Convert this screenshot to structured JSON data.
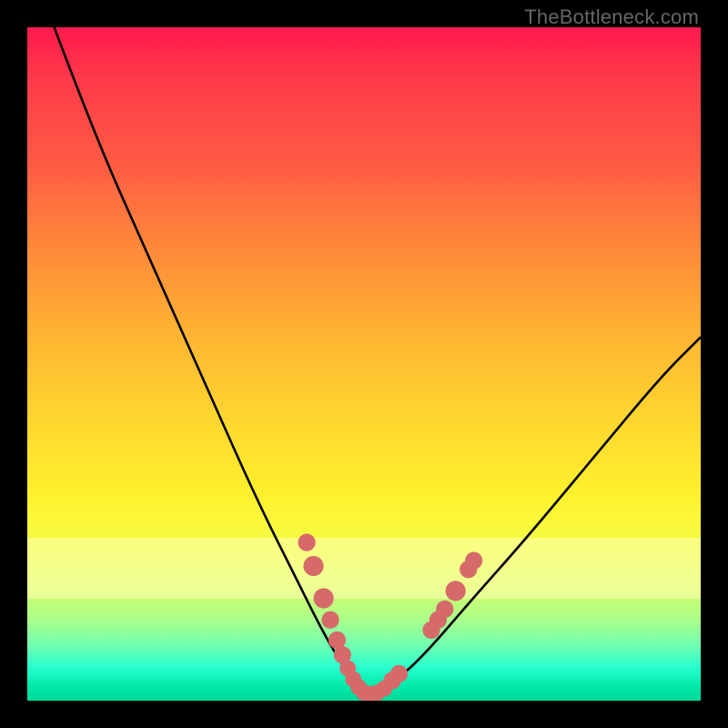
{
  "watermark": "TheBottleneck.com",
  "colors": {
    "frame": "#000000",
    "gradient_top": "#ff1a4d",
    "gradient_bottom": "#00d898",
    "curve": "#000000",
    "dots": "#d66a6a",
    "band": "#ffffb4"
  },
  "chart_data": {
    "type": "line",
    "title": "",
    "xlabel": "",
    "ylabel": "",
    "xlim": [
      0,
      100
    ],
    "ylim": [
      0,
      100
    ],
    "grid": false,
    "legend": false,
    "series": [
      {
        "name": "bottleneck-curve",
        "x": [
          4,
          10,
          18,
          26,
          34,
          40,
          44,
          47,
          49,
          50,
          51,
          53,
          56,
          60,
          66,
          74,
          84,
          94,
          100
        ],
        "y": [
          100,
          84,
          66,
          48,
          30,
          18,
          10,
          5,
          2,
          1,
          1,
          2,
          4,
          8,
          15,
          24,
          36,
          48,
          54
        ]
      }
    ],
    "markers": [
      {
        "x": 41.5,
        "y": 23.5,
        "r": 1.3
      },
      {
        "x": 42.5,
        "y": 20.0,
        "r": 1.5
      },
      {
        "x": 44.0,
        "y": 15.2,
        "r": 1.5
      },
      {
        "x": 45.0,
        "y": 12.0,
        "r": 1.3
      },
      {
        "x": 46.0,
        "y": 9.0,
        "r": 1.3
      },
      {
        "x": 46.8,
        "y": 6.8,
        "r": 1.3
      },
      {
        "x": 47.6,
        "y": 4.8,
        "r": 1.2
      },
      {
        "x": 48.4,
        "y": 3.2,
        "r": 1.2
      },
      {
        "x": 49.2,
        "y": 2.0,
        "r": 1.2
      },
      {
        "x": 50.0,
        "y": 1.2,
        "r": 1.2
      },
      {
        "x": 51.0,
        "y": 1.0,
        "r": 1.2
      },
      {
        "x": 52.0,
        "y": 1.2,
        "r": 1.2
      },
      {
        "x": 53.0,
        "y": 1.8,
        "r": 1.2
      },
      {
        "x": 54.2,
        "y": 3.0,
        "r": 1.3
      },
      {
        "x": 55.2,
        "y": 4.0,
        "r": 1.3
      },
      {
        "x": 60.0,
        "y": 10.5,
        "r": 1.3
      },
      {
        "x": 61.0,
        "y": 12.0,
        "r": 1.3
      },
      {
        "x": 62.0,
        "y": 13.6,
        "r": 1.3
      },
      {
        "x": 63.6,
        "y": 16.3,
        "r": 1.5
      },
      {
        "x": 65.5,
        "y": 19.5,
        "r": 1.3
      },
      {
        "x": 66.3,
        "y": 20.8,
        "r": 1.3
      }
    ]
  }
}
